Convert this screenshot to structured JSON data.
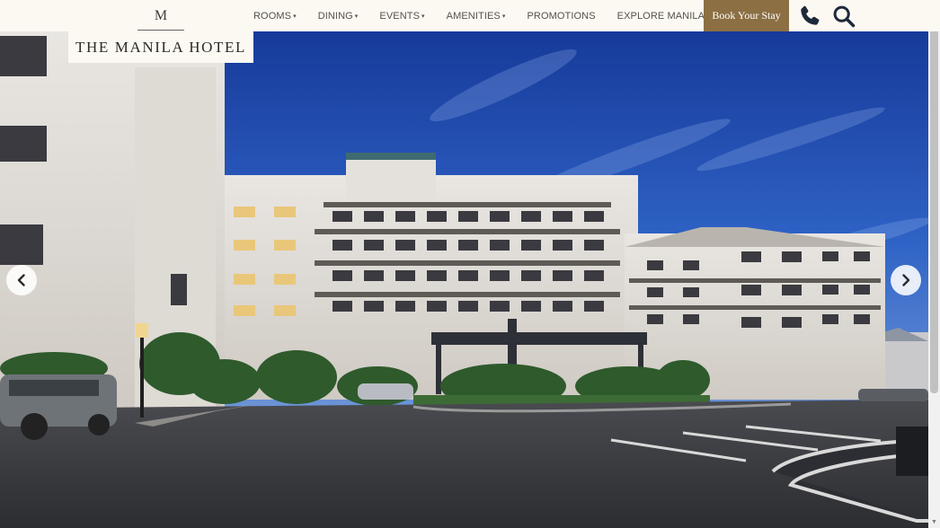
{
  "logo": {
    "mark": "M",
    "name": "THE MANILA HOTEL"
  },
  "nav": {
    "items": [
      {
        "label": "ROOMS",
        "has_dropdown": true
      },
      {
        "label": "DINING",
        "has_dropdown": true
      },
      {
        "label": "EVENTS",
        "has_dropdown": true
      },
      {
        "label": "AMENITIES",
        "has_dropdown": true
      },
      {
        "label": "PROMOTIONS",
        "has_dropdown": false
      },
      {
        "label": "EXPLORE MANILA",
        "has_dropdown": false
      }
    ],
    "caret": "▾",
    "book_label": "Book Your Stay",
    "phone_icon": "phone-icon",
    "search_icon": "search-icon"
  },
  "hero": {
    "prev_icon": "chevron-left-icon",
    "next_icon": "chevron-right-icon"
  },
  "colors": {
    "accent": "#8c6f43",
    "nav_bg": "#fbf9f2",
    "nav_text": "#55504a",
    "icon": "#1e2a3a"
  },
  "scrollbar": {
    "up": "▲",
    "down": "▼"
  }
}
